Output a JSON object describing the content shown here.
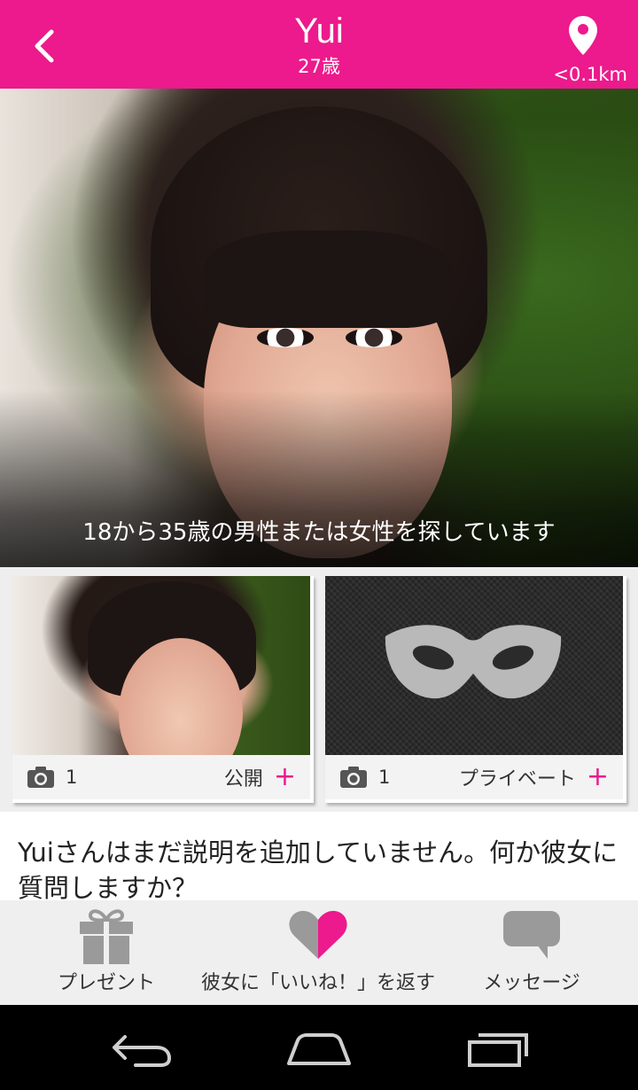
{
  "header": {
    "name": "Yui",
    "age": "27歳",
    "distance": "<0.1km",
    "accent_color": "#ec1a8c",
    "back_icon": "chevron-left-icon",
    "location_icon": "location-pin-icon"
  },
  "hero": {
    "caption": "18から35歳の男性または女性を探しています"
  },
  "gallery": {
    "public": {
      "count": "1",
      "label": "公開",
      "plus": "+"
    },
    "private": {
      "count": "1",
      "label": "プライベート",
      "plus": "+"
    }
  },
  "description": {
    "text": "Yuiさんはまだ説明を追加していません。何か彼女に質問しますか？"
  },
  "actions": {
    "gift": "プレゼント",
    "like": "彼女に「いいね！」を返す",
    "message": "メッセージ"
  },
  "system_nav": {
    "back_icon": "back-arrow-icon",
    "home_icon": "home-icon",
    "recents_icon": "recent-apps-icon"
  }
}
